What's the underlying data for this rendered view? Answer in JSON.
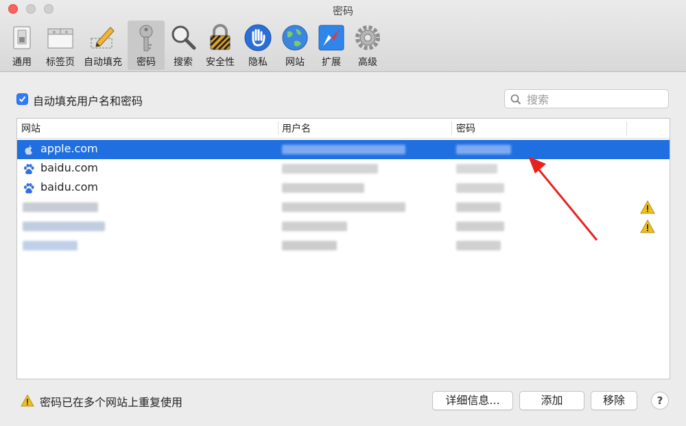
{
  "window": {
    "title": "密码"
  },
  "toolbar": {
    "items": [
      {
        "label": "通用",
        "icon": "switch-icon"
      },
      {
        "label": "标签页",
        "icon": "tabs-icon"
      },
      {
        "label": "自动填充",
        "icon": "pencil-icon"
      },
      {
        "label": "密码",
        "icon": "key-icon",
        "selected": true
      },
      {
        "label": "搜索",
        "icon": "magnifier-icon"
      },
      {
        "label": "安全性",
        "icon": "lock-icon"
      },
      {
        "label": "隐私",
        "icon": "hand-icon"
      },
      {
        "label": "网站",
        "icon": "globe-icon"
      },
      {
        "label": "扩展",
        "icon": "compass-icon"
      },
      {
        "label": "高级",
        "icon": "gear-icon"
      }
    ]
  },
  "autofill": {
    "label": "自动填充用户名和密码",
    "checked": true
  },
  "search": {
    "placeholder": "搜索",
    "value": ""
  },
  "table": {
    "columns": [
      "网站",
      "用户名",
      "密码"
    ],
    "rows": [
      {
        "site": "apple.com",
        "icon": "apple-icon",
        "selected": true
      },
      {
        "site": "baidu.com",
        "icon": "baidu-paw-icon"
      },
      {
        "site": "baidu.com",
        "icon": "baidu-paw-icon"
      },
      {
        "site": "",
        "warning": true
      },
      {
        "site": "",
        "warning": true
      },
      {
        "site": ""
      }
    ]
  },
  "footer": {
    "warning_text": "密码已在多个网站上重复使用",
    "details_button": "详细信息...",
    "add_button": "添加",
    "remove_button": "移除",
    "help_button": "?"
  },
  "colors": {
    "selection": "#1f6fe0",
    "checkbox": "#2e7cf6",
    "warning": "#f0c020"
  }
}
